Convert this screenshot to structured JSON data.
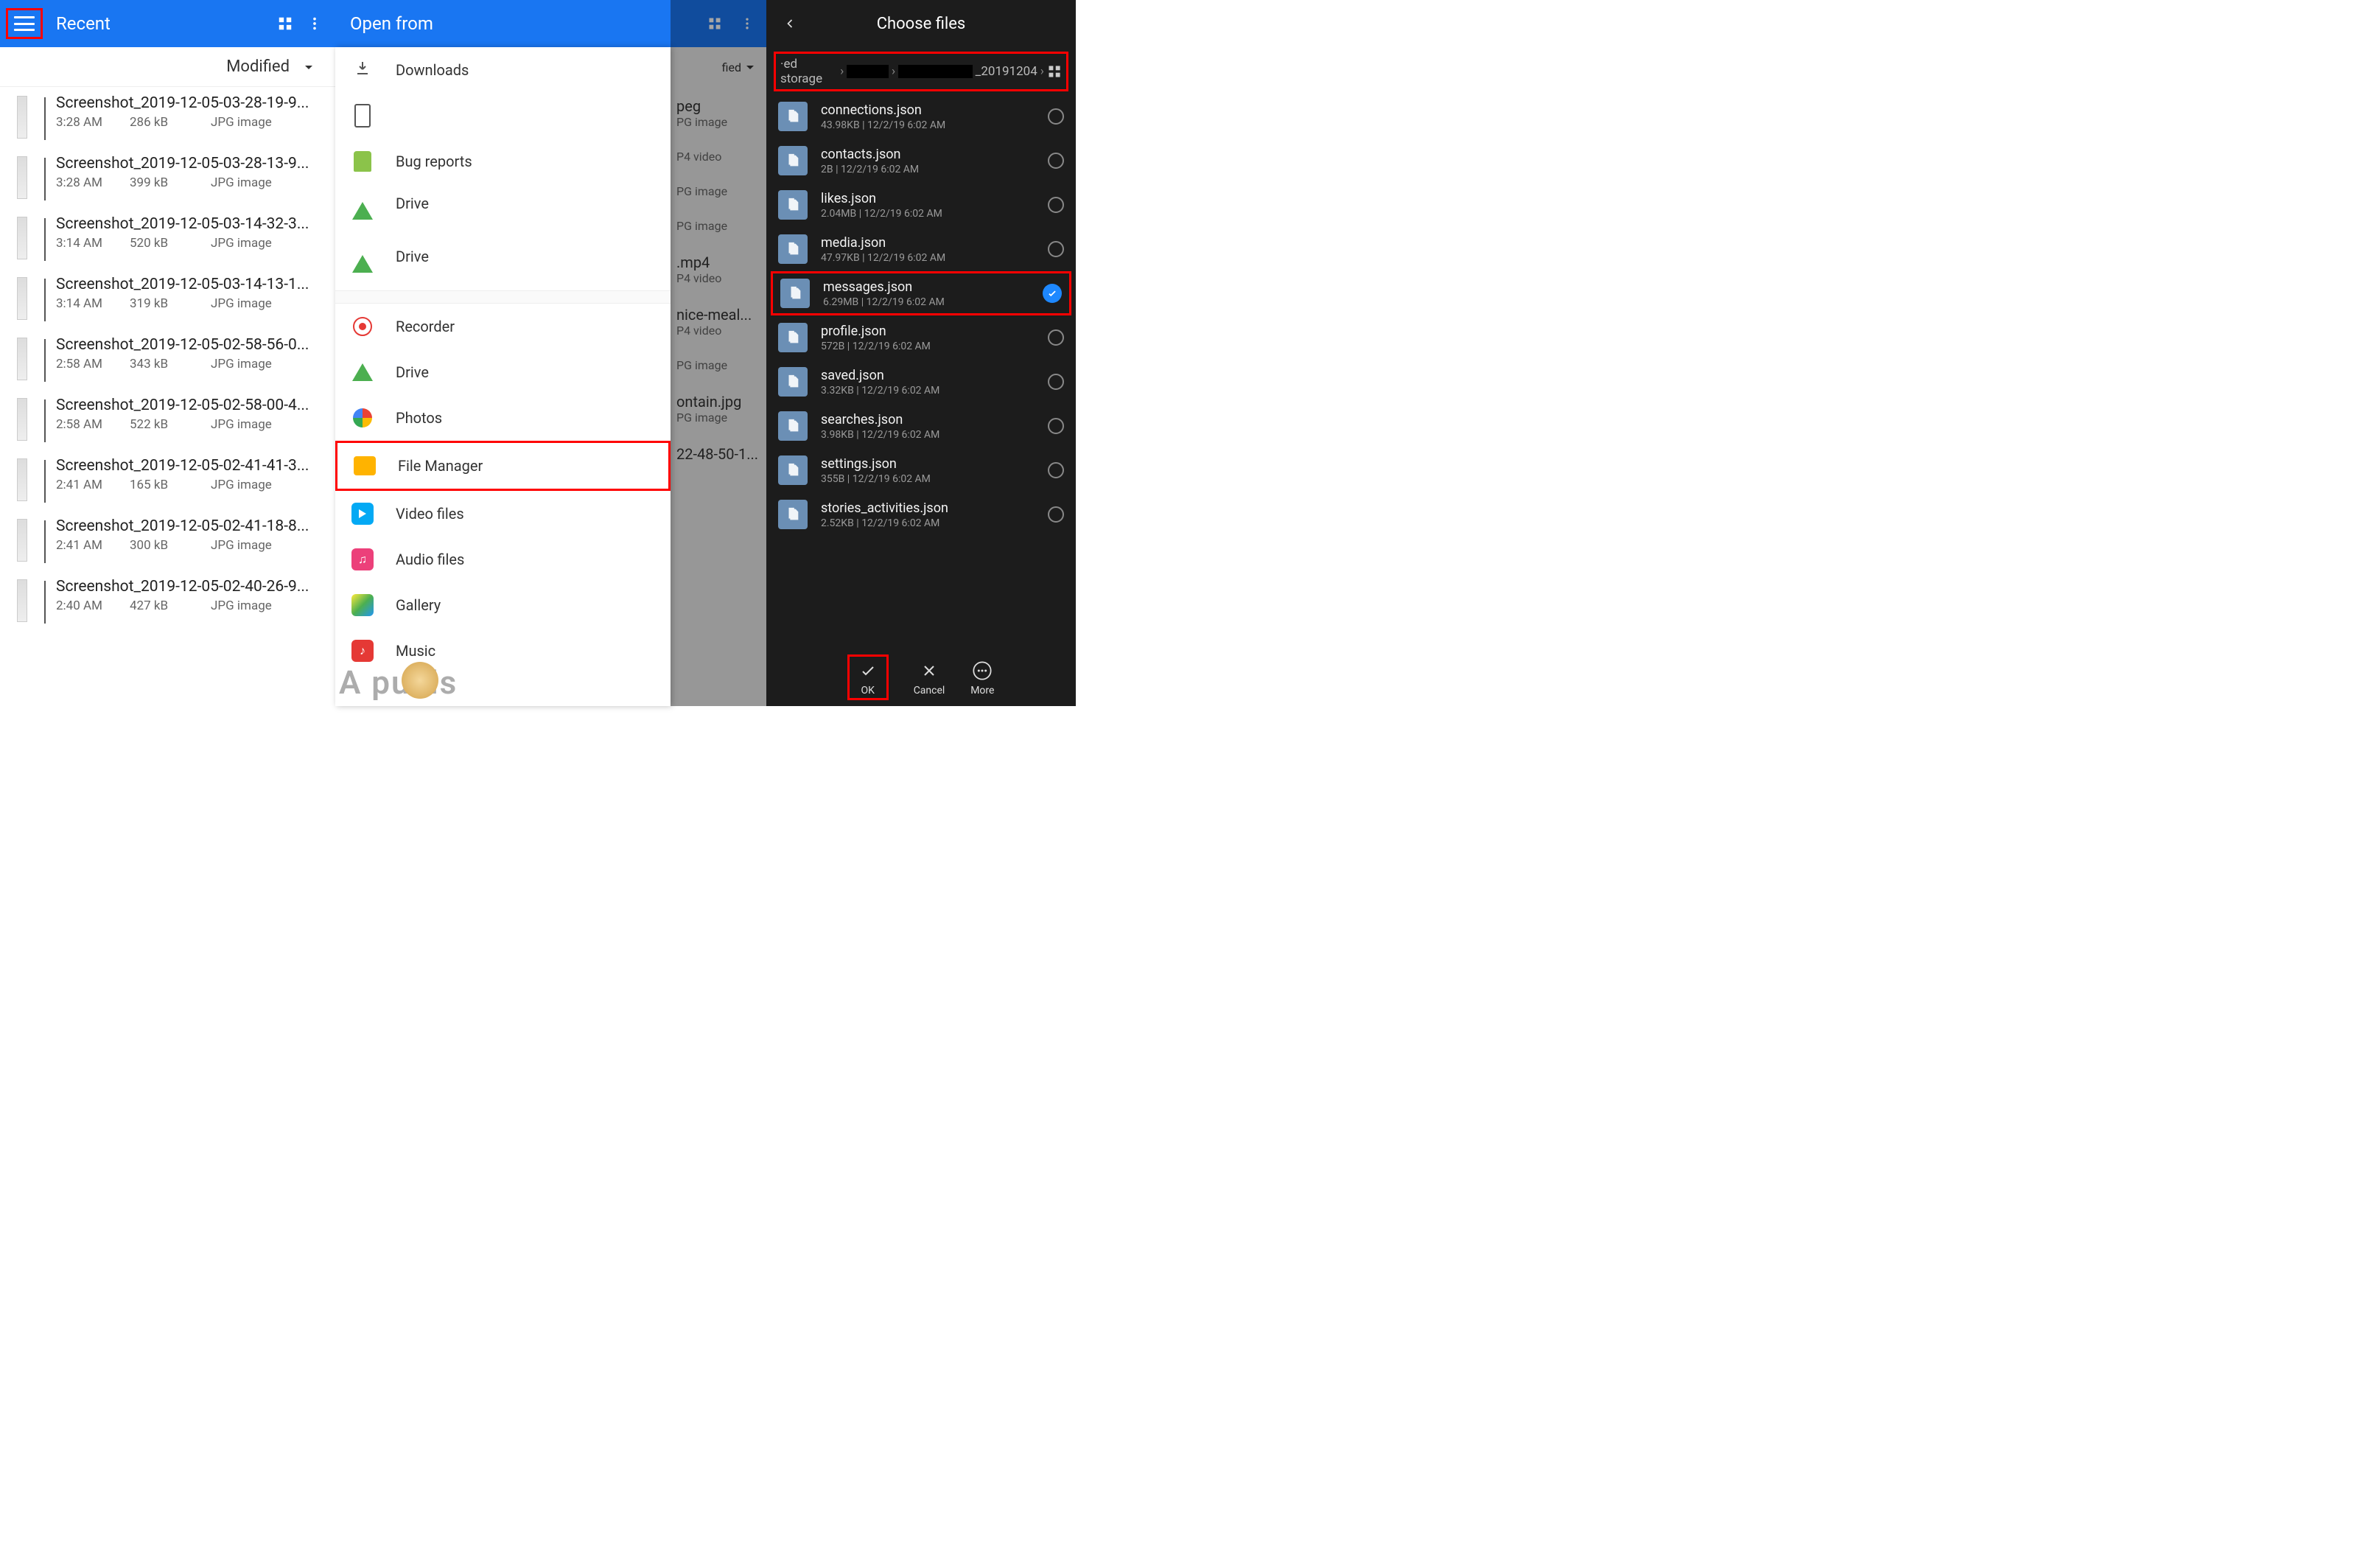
{
  "panel1": {
    "title": "Recent",
    "sort_label": "Modified",
    "items": [
      {
        "name": "Screenshot_2019-12-05-03-28-19-9...",
        "time": "3:28 AM",
        "size": "286 kB",
        "type": "JPG image"
      },
      {
        "name": "Screenshot_2019-12-05-03-28-13-9...",
        "time": "3:28 AM",
        "size": "399 kB",
        "type": "JPG image"
      },
      {
        "name": "Screenshot_2019-12-05-03-14-32-3...",
        "time": "3:14 AM",
        "size": "520 kB",
        "type": "JPG image"
      },
      {
        "name": "Screenshot_2019-12-05-03-14-13-1...",
        "time": "3:14 AM",
        "size": "319 kB",
        "type": "JPG image"
      },
      {
        "name": "Screenshot_2019-12-05-02-58-56-0...",
        "time": "2:58 AM",
        "size": "343 kB",
        "type": "JPG image"
      },
      {
        "name": "Screenshot_2019-12-05-02-58-00-4...",
        "time": "2:58 AM",
        "size": "522 kB",
        "type": "JPG image"
      },
      {
        "name": "Screenshot_2019-12-05-02-41-41-3...",
        "time": "2:41 AM",
        "size": "165 kB",
        "type": "JPG image"
      },
      {
        "name": "Screenshot_2019-12-05-02-41-18-8...",
        "time": "2:41 AM",
        "size": "300 kB",
        "type": "JPG image"
      },
      {
        "name": "Screenshot_2019-12-05-02-40-26-9...",
        "time": "2:40 AM",
        "size": "427 kB",
        "type": "JPG image"
      }
    ]
  },
  "panel2": {
    "title": "Open from",
    "items": [
      {
        "icon": "download",
        "label": "Downloads"
      },
      {
        "icon": "phone",
        "label": ""
      },
      {
        "icon": "bug",
        "label": "Bug reports"
      },
      {
        "icon": "drive",
        "label": "Drive",
        "sub": ""
      },
      {
        "icon": "drive",
        "label": "Drive",
        "sub": ""
      },
      {
        "icon": "rec",
        "label": "Recorder"
      },
      {
        "icon": "drive",
        "label": "Drive"
      },
      {
        "icon": "photos",
        "label": "Photos"
      },
      {
        "icon": "fm",
        "label": "File Manager"
      },
      {
        "icon": "vid",
        "label": "Video files"
      },
      {
        "icon": "aud",
        "label": "Audio files"
      },
      {
        "icon": "gal",
        "label": "Gallery"
      },
      {
        "icon": "mus",
        "label": "Music"
      }
    ]
  },
  "panel2b": {
    "sort_label": "fied",
    "items": [
      {
        "name": "peg",
        "meta": "PG image"
      },
      {
        "name": "",
        "meta": "P4 video"
      },
      {
        "name": "",
        "meta": "PG image"
      },
      {
        "name": "",
        "meta": "PG image"
      },
      {
        "name": ".mp4",
        "meta": "P4 video"
      },
      {
        "name": "nice-meal...",
        "meta": "P4 video"
      },
      {
        "name": "",
        "meta": "PG image"
      },
      {
        "name": "ontain.jpg",
        "meta": "PG image"
      },
      {
        "name": "22-48-50-1...",
        "meta": ""
      }
    ]
  },
  "panel3": {
    "title": "Choose files",
    "breadcrumb": {
      "pre": "·ed storage",
      "suffix": "_20191204"
    },
    "items": [
      {
        "name": "connections.json",
        "size": "43.98KB",
        "date": "12/2/19 6:02 AM",
        "selected": false
      },
      {
        "name": "contacts.json",
        "size": "2B",
        "date": "12/2/19 6:02 AM",
        "selected": false
      },
      {
        "name": "likes.json",
        "size": "2.04MB",
        "date": "12/2/19 6:02 AM",
        "selected": false
      },
      {
        "name": "media.json",
        "size": "47.97KB",
        "date": "12/2/19 6:02 AM",
        "selected": false
      },
      {
        "name": "messages.json",
        "size": "6.29MB",
        "date": "12/2/19 6:02 AM",
        "selected": true
      },
      {
        "name": "profile.json",
        "size": "572B",
        "date": "12/2/19 6:02 AM",
        "selected": false
      },
      {
        "name": "saved.json",
        "size": "3.32KB",
        "date": "12/2/19 6:02 AM",
        "selected": false
      },
      {
        "name": "searches.json",
        "size": "3.98KB",
        "date": "12/2/19 6:02 AM",
        "selected": false
      },
      {
        "name": "settings.json",
        "size": "355B",
        "date": "12/2/19 6:02 AM",
        "selected": false
      },
      {
        "name": "stories_activities.json",
        "size": "2.52KB",
        "date": "12/2/19 6:02 AM",
        "selected": false
      }
    ],
    "footer": {
      "ok": "OK",
      "cancel": "Cancel",
      "more": "More"
    }
  },
  "watermark": "A   puals"
}
